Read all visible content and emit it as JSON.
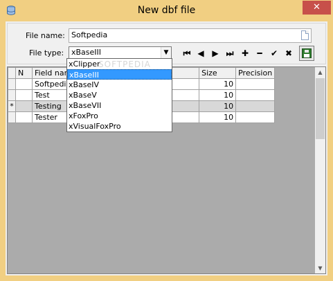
{
  "window": {
    "title": "New dbf file",
    "close_glyph": "✕"
  },
  "form": {
    "file_name_label": "File name:",
    "file_name_value": "Softpedia",
    "file_type_label": "File type:",
    "file_type_value": "xBaseIII"
  },
  "toolbar": {
    "buttons": [
      {
        "name": "first-record",
        "glyph": "⏮"
      },
      {
        "name": "prev-record",
        "glyph": "◀"
      },
      {
        "name": "next-record",
        "glyph": "▶"
      },
      {
        "name": "last-record",
        "glyph": "⏭"
      },
      {
        "name": "add-record",
        "glyph": "✚"
      },
      {
        "name": "delete-record",
        "glyph": "━"
      },
      {
        "name": "confirm",
        "glyph": "✔"
      },
      {
        "name": "cancel",
        "glyph": "✖"
      }
    ]
  },
  "grid": {
    "columns": [
      "N",
      "Field name",
      "",
      "Size",
      "Precision"
    ],
    "rows": [
      {
        "indicator": "",
        "name": "Softpedia",
        "size": "10",
        "precision": ""
      },
      {
        "indicator": "",
        "name": "Test",
        "size": "10",
        "precision": ""
      },
      {
        "indicator": "*",
        "name": "Testing",
        "size": "10",
        "precision": ""
      },
      {
        "indicator": "",
        "name": "Tester",
        "size": "10",
        "precision": ""
      }
    ]
  },
  "dropdown": {
    "options": [
      "xClipper",
      "xBaseIII",
      "xBaseIV",
      "xBaseV",
      "xBaseVII",
      "xFoxPro",
      "xVisualFoxPro"
    ],
    "selected_index": 1
  },
  "watermark": "SOFTPEDIA",
  "colors": {
    "frame": "#f1cf82",
    "close": "#c7504a",
    "selection": "#3399ff"
  }
}
